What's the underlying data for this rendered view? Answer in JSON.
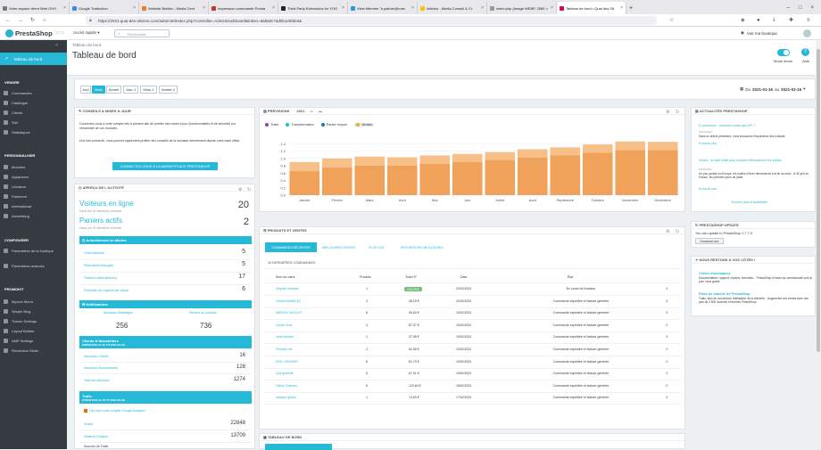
{
  "browser": {
    "tabs": [
      {
        "label": "Votre espace client Web OVH"
      },
      {
        "label": "Google Traduction"
      },
      {
        "label": "Website Builder - Media Cent"
      },
      {
        "label": "Impression commande Presta"
      },
      {
        "label": "Third-Party Extensions for YOO"
      },
      {
        "label": "View Member \"k.palmer@mac"
      },
      {
        "label": "Articles - Media Conseil & Cr"
      },
      {
        "label": "index.php (Image WEBP, 2560 ×"
      },
      {
        "label": "Tableau de bord • Quai des Oli"
      }
    ],
    "url": "https://2021.quai-des-oliviers.com/admin30/index.php?controller=AdminDashboard&token=9a8a0c7ad0b1e5fab4&"
  },
  "ps_top": {
    "logo": "PrestaShop",
    "version": "1.7.7.1",
    "quick_access": "Accès rapide ▾",
    "search_placeholder": "Rechercher",
    "view_shop": "Voir ma boutique"
  },
  "sidebar": {
    "sections": [
      "VENDRE",
      "PERSONNALISER",
      "CONFIGURER",
      "PROMOKIT"
    ],
    "dashboard": "Tableau de bord",
    "items_sell": [
      "Commandes",
      "Catalogue",
      "Clients",
      "SAV",
      "Statistiques"
    ],
    "items_custom": [
      "Modules",
      "Apparence",
      "Livraison",
      "Paiement",
      "International",
      "Advertising"
    ],
    "items_config": [
      "Paramètres de la boutique",
      "Paramètres avancés"
    ],
    "items_promokit": [
      "Mycom Menu",
      "Simple Blog",
      "Theme Settings",
      "Layout Builder",
      "AMP Settings",
      "Revolution Slider"
    ]
  },
  "header": {
    "breadcrumb": "Tableau de bord",
    "title": "Tableau de bord",
    "demo_mode": "Mode démo",
    "help": "Aide"
  },
  "period": {
    "buttons": [
      "Jour",
      "Mois",
      "Année",
      "Jour-1",
      "Mois-1",
      "Année-1"
    ],
    "active": "Mois",
    "range_prefix": "Du",
    "date_from": "2021-01-16",
    "range_mid": "au",
    "date_to": "2021-02-16"
  },
  "connect": {
    "title": "CONSEILS & MISES À JOUR",
    "text1": "Connectez-vous à votre compte dès à présent afin de profiter des mises à jour (fonctionnalités et de sécurité) sur l'ensemble de vos modules.",
    "text2": "Une fois connecté, vous pourrez également profiter des conseils de la semaine directement depuis votre back office.",
    "button": "CONNECTEZ-VOUS À LA MARKETPLACE PRESTASHOP"
  },
  "activity": {
    "title": "APERÇU DE L'ACTIVITÉ",
    "visitors_label": "Visiteurs en ligne",
    "visitors_sub": "Dans les 30 dernières minutes",
    "visitors_value": "20",
    "carts_label": "Paniers actifs",
    "carts_sub": "Dans les 30 dernières minutes",
    "carts_value": "2",
    "pending_title": "Actuellement en attente",
    "pending": [
      {
        "label": "Commandes",
        "value": "5"
      },
      {
        "label": "Retours/Échanges",
        "value": "5"
      },
      {
        "label": "Paniers abandonnés",
        "value": "17"
      },
      {
        "label": "Produits en rupture de stock",
        "value": "6"
      }
    ],
    "notif_title": "Notifications",
    "new_messages_label": "Nouveaux Messages",
    "new_messages_value": "256",
    "product_reviews_label": "Retours de produits",
    "product_reviews_value": "736",
    "customers_title": "Clients & Newsletters",
    "customers_sub": "(FROM 2021-01-16 TO 2021-02-16)",
    "customers": [
      {
        "label": "Nouveaux Clients",
        "value": "16"
      },
      {
        "label": "Nouveaux Abonnements",
        "value": "128"
      },
      {
        "label": "Total des Abonnés",
        "value": "1274"
      }
    ],
    "traffic_title": "Trafic",
    "traffic_sub": "(FROM 2021-01-16 TO 2021-02-16)",
    "ga_link": "Lien vers votre compte Google Analytics",
    "traffic": [
      {
        "label": "Visites",
        "value": "22848"
      },
      {
        "label": "Visiteurs Uniques",
        "value": "13709"
      },
      {
        "label": "Sources de Trafic",
        "value": ""
      }
    ]
  },
  "forecast": {
    "title": "PRÉVISIONS",
    "year": "2021",
    "legend": [
      {
        "name": "Trafic",
        "color": "#8e44ad"
      },
      {
        "name": "Transformation",
        "color": "#25b9d7"
      },
      {
        "name": "Panier moyen",
        "color": "#1f77b4"
      },
      {
        "name": "Ventes",
        "color": "#f5a623"
      }
    ]
  },
  "chart_data": {
    "type": "bar",
    "categories": [
      "Janvier",
      "Février",
      "Mars",
      "Avril",
      "Mai",
      "Juin",
      "Juillet",
      "Août",
      "Septembre",
      "Octobre",
      "Novembre",
      "Décembre"
    ],
    "series": [
      {
        "name": "Ventes",
        "values": [
          0.9,
          1.0,
          1.05,
          1.03,
          1.08,
          1.12,
          1.17,
          1.25,
          1.3,
          1.38,
          1.46,
          1.45
        ]
      },
      {
        "name": "",
        "values": [
          0.65,
          0.75,
          0.8,
          0.8,
          0.85,
          0.9,
          0.95,
          1.02,
          1.08,
          1.15,
          1.22,
          1.22
        ]
      }
    ],
    "yticks": [
      "1.4",
      "1.2",
      "1.0",
      "0.8",
      "0.6",
      "0.4",
      "0.2",
      "0.0"
    ],
    "ylim": [
      0,
      1.6
    ],
    "colors": [
      "#f7c089",
      "#f0a25a"
    ]
  },
  "products": {
    "title": "PRODUITS ET VENTES",
    "tabs": [
      "COMMANDES RÉCENTES",
      "MEILLEURES VENTES",
      "PLUS VUS",
      "RECHERCHES MEILLEURES"
    ],
    "subtitle": "10 DERNIÈRES COMMANDES",
    "columns": [
      "Nom du client",
      "Produits",
      "Total HT",
      "Date",
      "État"
    ],
    "rows": [
      {
        "name": "Virginie Daladéa",
        "qty": "1",
        "total": "123,79 €",
        "date": "20/02/2021",
        "state": "En cours de livraison"
      },
      {
        "name": "Gerard ANNELAC",
        "qty": "3",
        "total": "48,15 €",
        "date": "20/02/2021",
        "state": "Commande expédiée et facture générée"
      },
      {
        "name": "MARCEL WOLLET",
        "qty": "8",
        "total": "95,63 €",
        "date": "19/02/2021",
        "state": "Commande expédiée et facture générée"
      },
      {
        "name": "Cécile Civin",
        "qty": "4",
        "total": "87,37 €",
        "date": "19/02/2021",
        "state": "Commande expédiée et facture générée"
      },
      {
        "name": "Jean barbius",
        "qty": "1",
        "total": "37,08 €",
        "date": "19/02/2021",
        "state": "Commande expédiée et facture générée"
      },
      {
        "name": "Frédéric vet",
        "qty": "2",
        "total": "62,08 €",
        "date": "19/02/2021",
        "state": "Commande expédiée et facture générée"
      },
      {
        "name": "ERIC GRAVIER",
        "qty": "6",
        "total": "61,70 €",
        "date": "19/02/2021",
        "state": "Commande expédiée et facture générée"
      },
      {
        "name": "Lynl guidonit",
        "qty": "5",
        "total": "67,01 €",
        "date": "19/02/2021",
        "state": "Commande expédiée et facture générée"
      },
      {
        "name": "Olivier Guerard",
        "qty": "6",
        "total": "120,60 €",
        "date": "18/02/2021",
        "state": "Commande expédiée et facture générée"
      },
      {
        "name": "maxime gireau",
        "qty": "1",
        "total": "74,63 €",
        "date": "17/02/2021",
        "state": "Commande expédiée et facture générée"
      }
    ]
  },
  "dashboard_table": {
    "title": "TABLEAU DE BORD"
  },
  "news": {
    "title": "ACTUALITÉS PRESTASHOP",
    "items": [
      {
        "title": "E-commerce : comment suivre ses KPI ?",
        "date": "16/02/2021",
        "text": "Dans un article précédent, nous évoquions l'importance des Indicate",
        "more": "En savoir plus"
      },
      {
        "title": "Soldes : la date limite pour préparer efficacement les soldes",
        "date": "14/02/2021",
        "text": "Un peu partout en Europe, les soldes d'hiver démarreront à la fin du mois : le 30 juin en France, les premiers jours de juillet",
        "more": "En savoir plus"
      }
    ],
    "link": "Trouver plus d'actualités"
  },
  "update": {
    "title": "PRESTASHOP UPDATE",
    "text": "You can update to PrestaShop 1.7.7.3",
    "button": "Download now"
  },
  "resources": {
    "title": "NOUS RESTONS À VOS CÔTÉS !",
    "items": [
      {
        "title": "Centre d'assistance",
        "text": "Documentation, support, experts, formation... PrestaShop et toute sa communauté sont là pour vous guider"
      },
      {
        "title": "Place de marché de PrestaShop",
        "text": "Trafic, taux de conversion, fidélisation de la clientèle... Augmentez vos ventes avec nos plus de 3 500 modules et thèmes PrestaShop"
      }
    ]
  }
}
